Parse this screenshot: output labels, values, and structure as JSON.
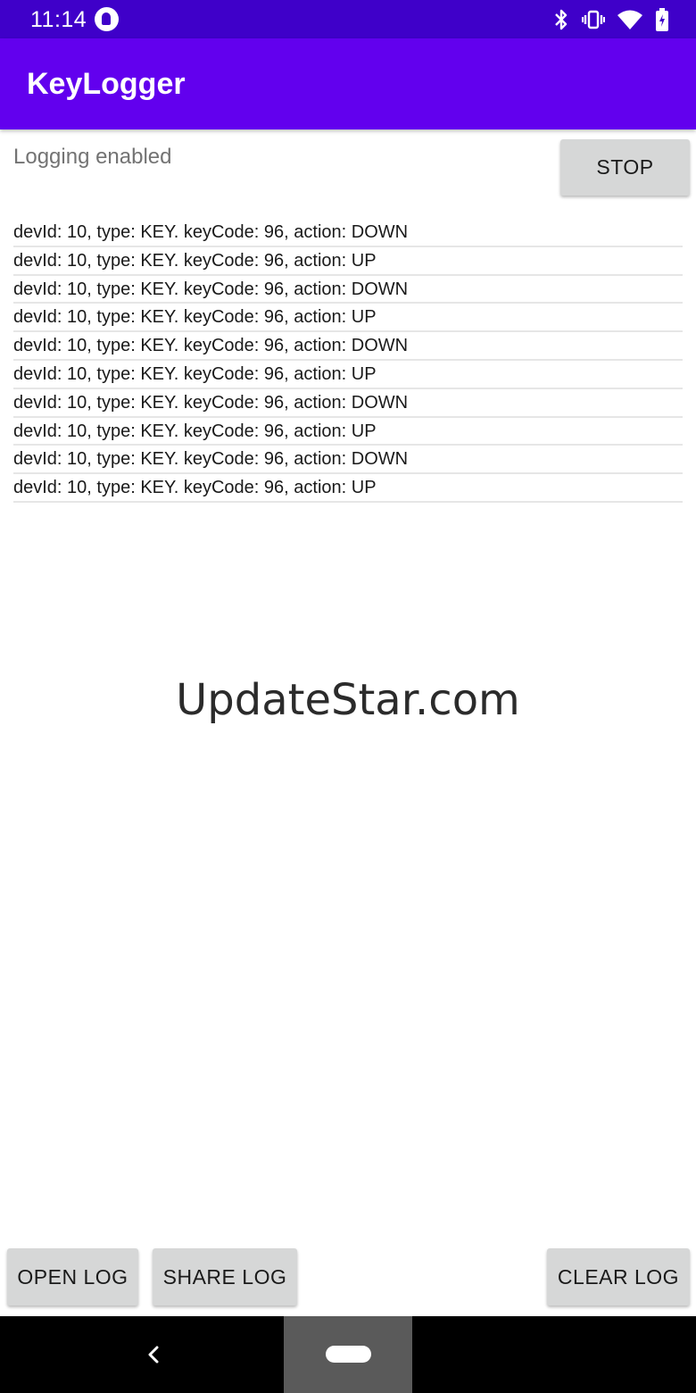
{
  "status_bar": {
    "time": "11:14",
    "icons": [
      "notification-app-icon",
      "bluetooth-icon",
      "vibrate-icon",
      "wifi-icon",
      "battery-icon"
    ]
  },
  "app_bar": {
    "title": "KeyLogger",
    "color": "#6200ee"
  },
  "logging": {
    "status": "Logging enabled",
    "stop_label": "STOP"
  },
  "log_entries": [
    "devId: 10, type: KEY. keyCode: 96, action: DOWN",
    "devId: 10, type: KEY. keyCode: 96, action: UP",
    "devId: 10, type: KEY. keyCode: 96, action: DOWN",
    "devId: 10, type: KEY. keyCode: 96, action: UP",
    "devId: 10, type: KEY. keyCode: 96, action: DOWN",
    "devId: 10, type: KEY. keyCode: 96, action: UP",
    "devId: 10, type: KEY. keyCode: 96, action: DOWN",
    "devId: 10, type: KEY. keyCode: 96, action: UP",
    "devId: 10, type: KEY. keyCode: 96, action: DOWN",
    "devId: 10, type: KEY. keyCode: 96, action: UP"
  ],
  "watermark": "UpdateStar.com",
  "actions": {
    "open_log": "OPEN LOG",
    "share_log": "SHARE LOG",
    "clear_log": "CLEAR LOG"
  },
  "nav_bar": {
    "icons": [
      "back-icon",
      "home-icon"
    ]
  }
}
